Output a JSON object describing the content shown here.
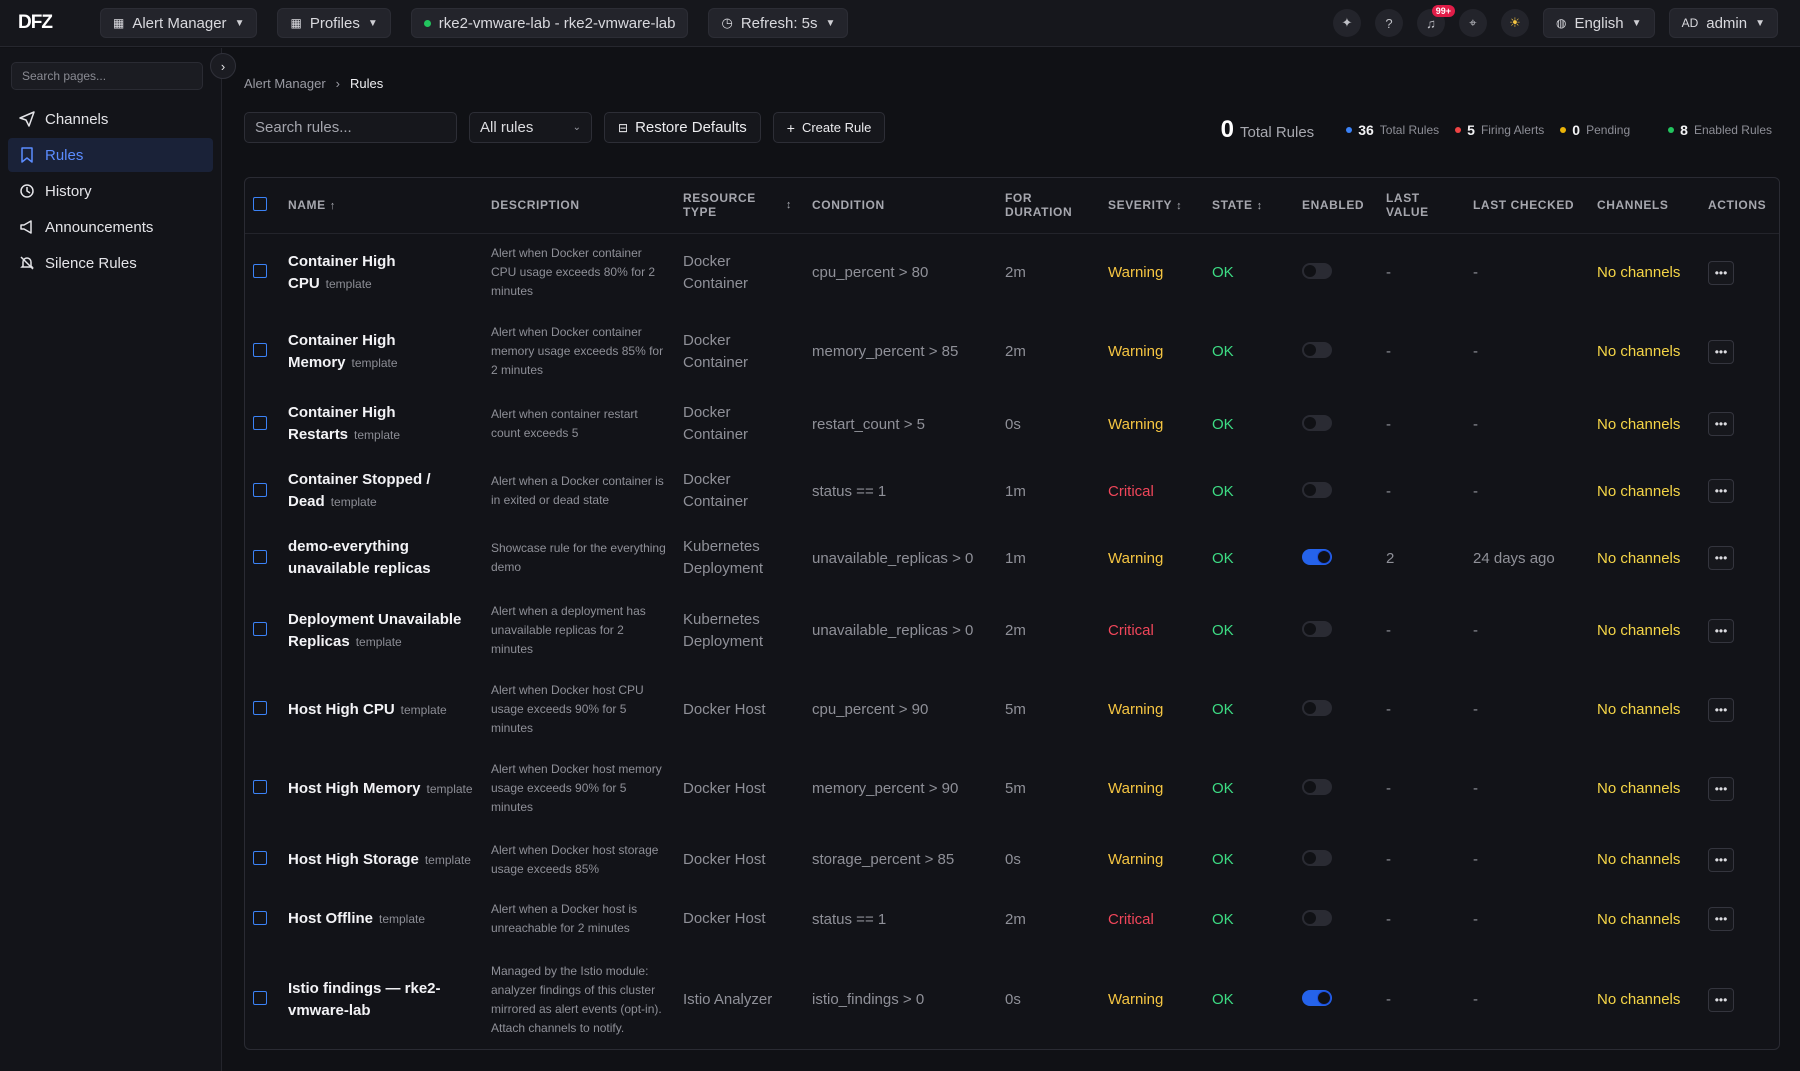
{
  "topbar": {
    "logo": "DFZ",
    "app_menu": "Alert Manager",
    "profiles": "Profiles",
    "cluster": "rke2-vmware-lab - rke2-vmware-lab",
    "refresh": "Refresh:  5s",
    "notif_badge": "99+",
    "language": "English",
    "user_initials": "AD",
    "user_name": "admin"
  },
  "sidebar": {
    "search_placeholder": "Search pages...",
    "items": [
      {
        "label": "Channels",
        "icon": "send-icon"
      },
      {
        "label": "Rules",
        "icon": "bookmark-icon"
      },
      {
        "label": "History",
        "icon": "history-icon"
      },
      {
        "label": "Announcements",
        "icon": "megaphone-icon"
      },
      {
        "label": "Silence Rules",
        "icon": "bell-off-icon"
      }
    ]
  },
  "breadcrumb": {
    "parent": "Alert Manager",
    "current": "Rules"
  },
  "toolbar": {
    "search_placeholder": "Search rules...",
    "filter_value": "All rules",
    "restore_label": "Restore Defaults",
    "create_label": "Create Rule"
  },
  "stats": {
    "shown_count": "0",
    "shown_label": "Total Rules",
    "total_count": "36",
    "total_label": "Total Rules",
    "firing_count": "5",
    "firing_label": "Firing Alerts",
    "pending_count": "0",
    "pending_label": "Pending",
    "enabled_count": "8",
    "enabled_label": "Enabled Rules",
    "colors": {
      "total": "#3b82f6",
      "firing": "#ef4444",
      "pending": "#eab308",
      "enabled": "#22c55e"
    }
  },
  "table": {
    "headers": {
      "name": "NAME",
      "description": "DESCRIPTION",
      "resource_type": "RESOURCE TYPE",
      "condition": "CONDITION",
      "for_duration": "FOR DURATION",
      "severity": "SEVERITY",
      "state": "STATE",
      "enabled": "ENABLED",
      "last_value": "LAST VALUE",
      "last_checked": "LAST CHECKED",
      "channels": "CHANNELS",
      "actions": "ACTIONS"
    },
    "rows": [
      {
        "name": "Container High CPU",
        "tag": "template",
        "description": "Alert when Docker container CPU usage exceeds 80% for 2 minutes",
        "resource_type": "Docker Container",
        "condition": "cpu_percent > 80",
        "duration": "2m",
        "severity": "Warning",
        "state": "OK",
        "enabled": false,
        "last_value": "-",
        "last_checked": "-",
        "channels": "No channels"
      },
      {
        "name": "Container High Memory",
        "tag": "template",
        "description": "Alert when Docker container memory usage exceeds 85% for 2 minutes",
        "resource_type": "Docker Container",
        "condition": "memory_percent > 85",
        "duration": "2m",
        "severity": "Warning",
        "state": "OK",
        "enabled": false,
        "last_value": "-",
        "last_checked": "-",
        "channels": "No channels"
      },
      {
        "name": "Container High Restarts",
        "tag": "template",
        "description": "Alert when container restart count exceeds 5",
        "resource_type": "Docker Container",
        "condition": "restart_count > 5",
        "duration": "0s",
        "severity": "Warning",
        "state": "OK",
        "enabled": false,
        "last_value": "-",
        "last_checked": "-",
        "channels": "No channels"
      },
      {
        "name": "Container Stopped / Dead",
        "tag": "template",
        "description": "Alert when a Docker container is in exited or dead state",
        "resource_type": "Docker Container",
        "condition": "status == 1",
        "duration": "1m",
        "severity": "Critical",
        "state": "OK",
        "enabled": false,
        "last_value": "-",
        "last_checked": "-",
        "channels": "No channels"
      },
      {
        "name": "demo-everything unavailable replicas",
        "tag": "",
        "description": "Showcase rule for the everything demo",
        "resource_type": "Kubernetes Deployment",
        "condition": "unavailable_replicas > 0",
        "duration": "1m",
        "severity": "Warning",
        "state": "OK",
        "enabled": true,
        "last_value": "2",
        "last_checked": "24 days ago",
        "channels": "No channels"
      },
      {
        "name": "Deployment Unavailable Replicas",
        "tag": "template",
        "description": "Alert when a deployment has unavailable replicas for 2 minutes",
        "resource_type": "Kubernetes Deployment",
        "condition": "unavailable_replicas > 0",
        "duration": "2m",
        "severity": "Critical",
        "state": "OK",
        "enabled": false,
        "last_value": "-",
        "last_checked": "-",
        "channels": "No channels"
      },
      {
        "name": "Host High CPU",
        "tag": "template",
        "description": "Alert when Docker host CPU usage exceeds 90% for 5 minutes",
        "resource_type": "Docker Host",
        "condition": "cpu_percent > 90",
        "duration": "5m",
        "severity": "Warning",
        "state": "OK",
        "enabled": false,
        "last_value": "-",
        "last_checked": "-",
        "channels": "No channels"
      },
      {
        "name": "Host High Memory",
        "tag": "template",
        "description": "Alert when Docker host memory usage exceeds 90% for 5 minutes",
        "resource_type": "Docker Host",
        "condition": "memory_percent > 90",
        "duration": "5m",
        "severity": "Warning",
        "state": "OK",
        "enabled": false,
        "last_value": "-",
        "last_checked": "-",
        "channels": "No channels"
      },
      {
        "name": "Host High Storage",
        "tag": "template",
        "description": "Alert when Docker host storage usage exceeds 85%",
        "resource_type": "Docker Host",
        "condition": "storage_percent > 85",
        "duration": "0s",
        "severity": "Warning",
        "state": "OK",
        "enabled": false,
        "last_value": "-",
        "last_checked": "-",
        "channels": "No channels"
      },
      {
        "name": "Host Offline",
        "tag": "template",
        "description": "Alert when a Docker host is unreachable for 2 minutes",
        "resource_type": "Docker Host",
        "condition": "status == 1",
        "duration": "2m",
        "severity": "Critical",
        "state": "OK",
        "enabled": false,
        "last_value": "-",
        "last_checked": "-",
        "channels": "No channels"
      },
      {
        "name": "Istio findings — rke2-vmware-lab",
        "tag": "",
        "description": "Managed by the Istio module: analyzer findings of this cluster mirrored as alert events (opt-in). Attach channels to notify.",
        "resource_type": "Istio Analyzer",
        "condition": "istio_findings > 0",
        "duration": "0s",
        "severity": "Warning",
        "state": "OK",
        "enabled": true,
        "last_value": "-",
        "last_checked": "-",
        "channels": "No channels"
      }
    ]
  }
}
